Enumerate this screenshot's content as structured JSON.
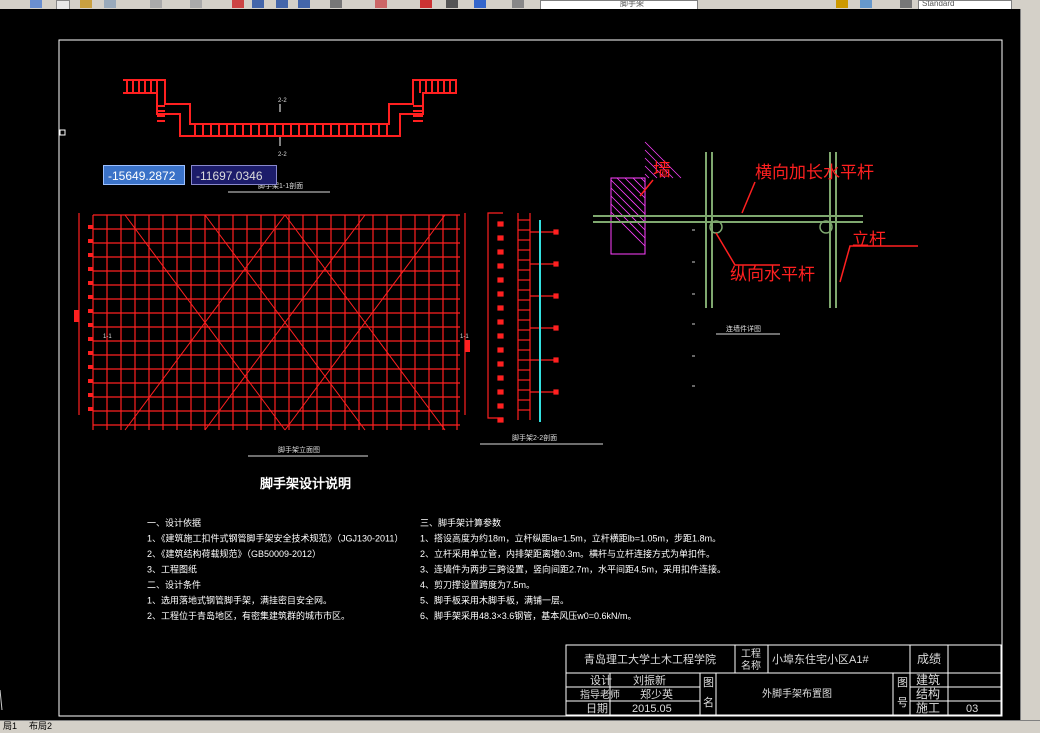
{
  "toolbar": {
    "layer_name": "脚手架",
    "text_style": "Standard"
  },
  "coordinates": {
    "x": "-15649.2872",
    "y": "-11697.0346"
  },
  "drawing": {
    "section_top_label_a": "2-2",
    "section_top_label_b": "2-2",
    "section_title": "脚手架1-1剖面",
    "elevation_title": "脚手架立面图",
    "side_title": "脚手架2-2剖面",
    "elev_left_marker": "1-1",
    "elev_right_marker": "1-1",
    "detail": {
      "wall": "墙",
      "transverse_bar": "横向加长水平杆",
      "longitudinal_bar": "纵向水平杆",
      "pole": "立杆",
      "caption": "连墙件详图"
    },
    "notes_title": "脚手架设计说明",
    "notes_left": [
      "一、设计依据",
      "1、《建筑施工扣件式钢管脚手架安全技术规范》（JGJ130-2011）",
      "2、《建筑结构荷载规范》（GB50009-2012）",
      "3、工程图纸",
      "二、设计条件",
      "1、选用落地式钢管脚手架，满挂密目安全网。",
      "2、工程位于青岛地区，有密集建筑群的城市市区。"
    ],
    "notes_right": [
      "三、脚手架计算参数",
      "1、搭设高度为约18m，立杆纵距la=1.5m，立杆横距lb=1.05m，步距1.8m。",
      "2、立杆采用单立管，内排架距离墙0.3m。横杆与立杆连接方式为单扣件。",
      "3、连墙件为两步三跨设置，竖向间距2.7m，水平间距4.5m，采用扣件连接。",
      "4、剪刀撑设置跨度为7.5m。",
      "5、脚手板采用木脚手板，满铺一层。",
      "6、脚手架采用48.3×3.6钢管，基本风压w0=0.6kN/m。"
    ]
  },
  "title_block": {
    "school": "青岛理工大学土木工程学院",
    "project_label_1": "工程",
    "project_label_2": "名称",
    "project_name": "小埠东住宅小区A1#",
    "score_label": "成绩",
    "design_label": "设计",
    "designer": "刘振新",
    "advisor_label": "指导老师",
    "advisor": "郑少英",
    "date_label": "日期",
    "date": "2015.05",
    "drawing_label_1": "图",
    "drawing_label_2": "名",
    "drawing_name": "外脚手架布置图",
    "number_label_1": "图",
    "number_label_2": "号",
    "disc_1": "建筑",
    "disc_2": "结构",
    "disc_3": "施工",
    "sheet_no": "03"
  },
  "tabs": [
    "局1",
    "布局2"
  ]
}
